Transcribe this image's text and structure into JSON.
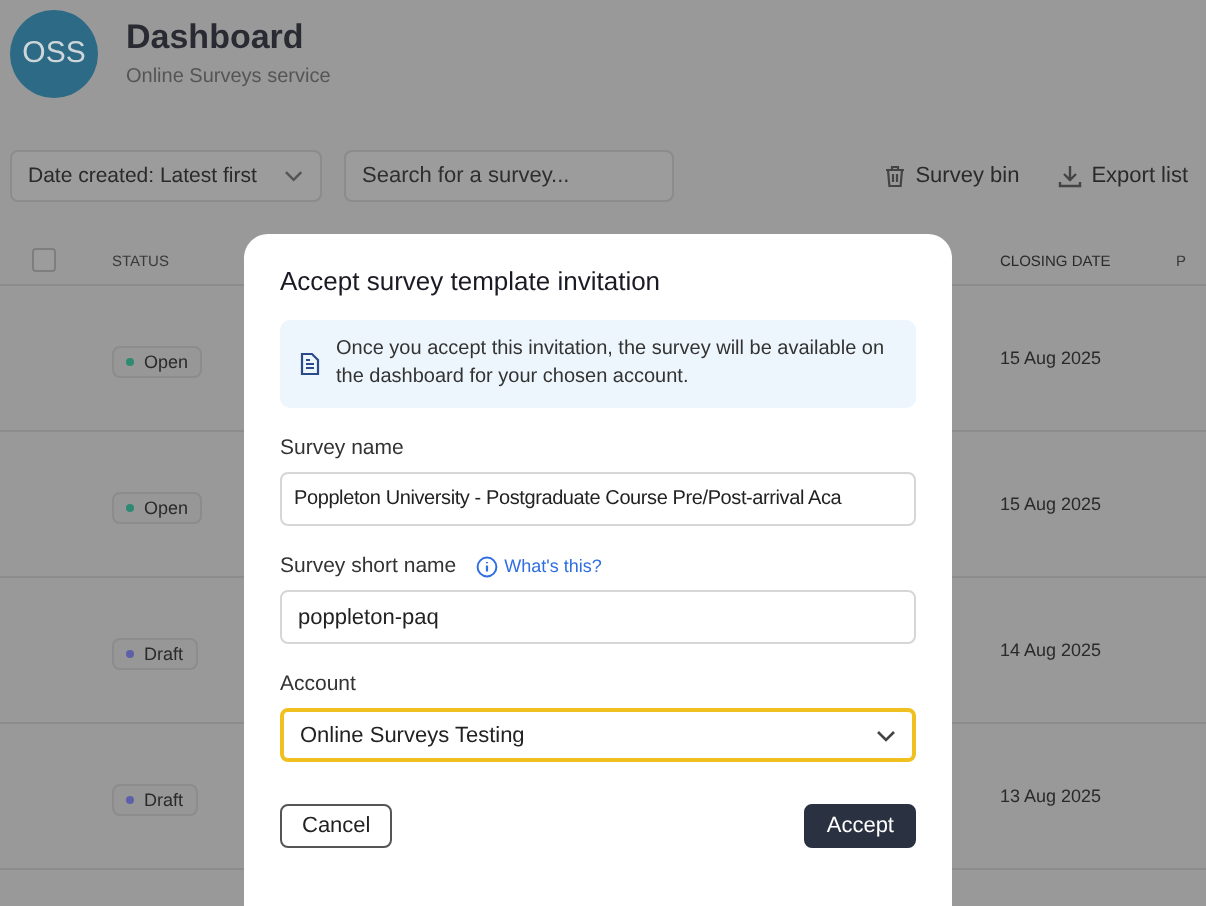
{
  "header": {
    "avatar": "OSS",
    "title": "Dashboard",
    "subtitle": "Online Surveys service"
  },
  "toolbar": {
    "sort": "Date created: Latest first",
    "search": {
      "placeholder": "Search for a survey..."
    },
    "actions": [
      "Survey bin",
      "Export list"
    ]
  },
  "table": {
    "select_all": {
      "checked": false
    },
    "columns": [
      "STATUS",
      "CLOSING DATE",
      "P"
    ],
    "rows": [
      {
        "status": "Open",
        "color": "#2e8a72",
        "closing_date": "15 Aug 2025"
      },
      {
        "status": "Open",
        "color": "#2e8a72",
        "closing_date": "15 Aug 2025"
      },
      {
        "status": "Draft",
        "color": "#5d5fa8",
        "closing_date": "14 Aug 2025"
      },
      {
        "status": "Draft",
        "color": "#5d5fa8",
        "closing_date": "13 Aug 2025"
      }
    ]
  },
  "dialog": {
    "title": "Accept survey template invitation",
    "info": "Once you accept this invitation, the survey will be available on the dashboard for your chosen account.",
    "fields": [
      {
        "kind": "text",
        "label": "Survey name",
        "value": "Poppleton University - Postgraduate Course Pre/Post-arrival Aca",
        "focused": false
      },
      {
        "kind": "text",
        "label": "Survey short name",
        "help": "What's this?",
        "value": "poppleton-paq",
        "focused": false
      },
      {
        "kind": "select",
        "label": "Account",
        "value": "Online Surveys Testing",
        "focused": true
      }
    ],
    "buttons": [
      {
        "kind": "secondary",
        "label": "Cancel"
      },
      {
        "kind": "primary",
        "label": "Accept"
      }
    ]
  }
}
